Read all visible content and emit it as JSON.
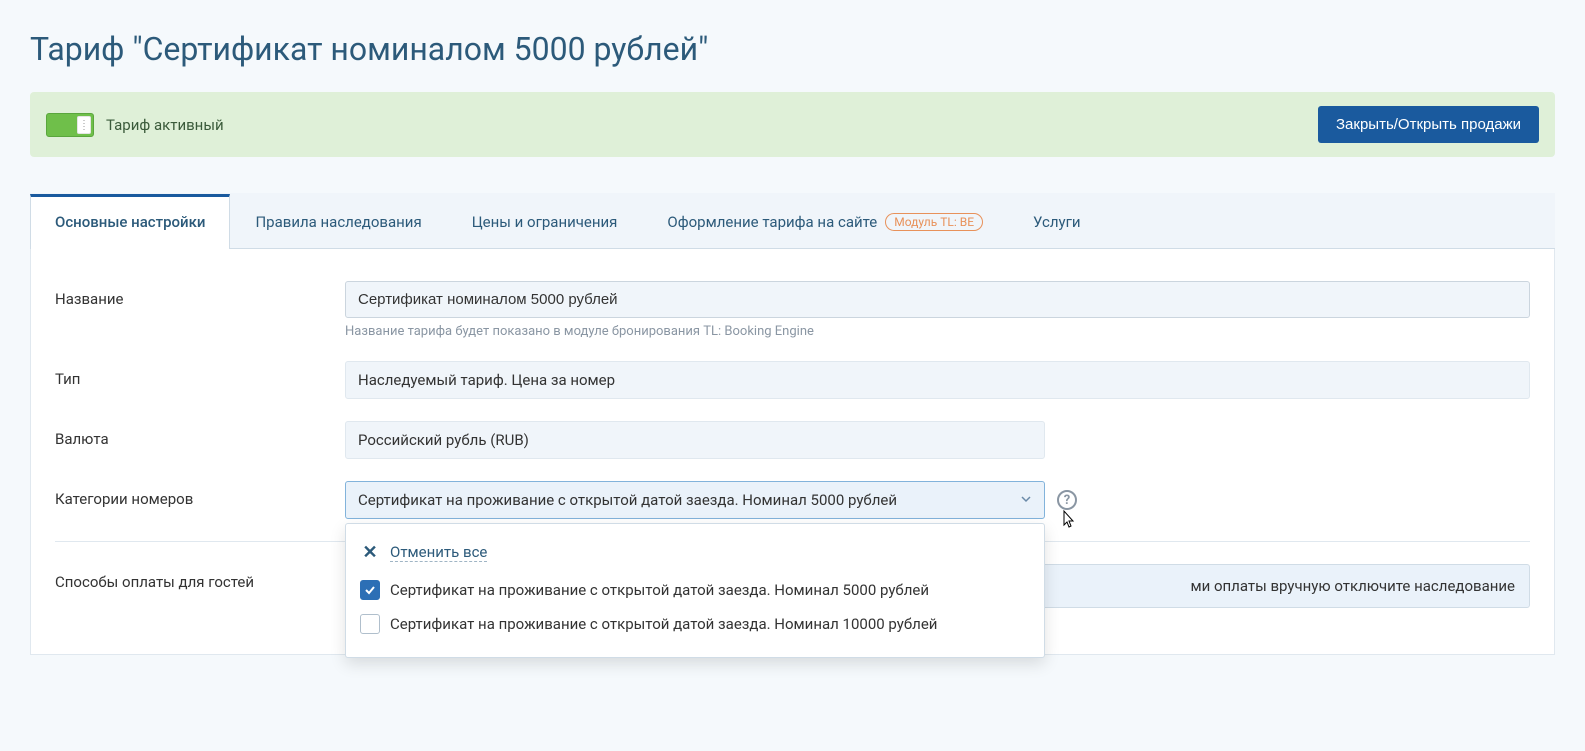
{
  "page_title": "Тариф \"Сертификат номиналом 5000 рублей\"",
  "status": {
    "label": "Тариф активный",
    "button": "Закрыть/Открыть продажи"
  },
  "tabs": [
    {
      "label": "Основные настройки"
    },
    {
      "label": "Правила наследования"
    },
    {
      "label": "Цены и ограничения"
    },
    {
      "label": "Оформление тарифа на сайте",
      "module_badge": "Модуль TL: BE"
    },
    {
      "label": "Услуги"
    }
  ],
  "form": {
    "name_label": "Название",
    "name_value": "Сертификат номиналом 5000 рублей",
    "name_helper": "Название тарифа будет показано в модуле бронирования TL: Booking Engine",
    "type_label": "Тип",
    "type_value": "Наследуемый тариф. Цена за номер",
    "currency_label": "Валюта",
    "currency_value": "Российский рубль (RUB)",
    "categories_label": "Категории номеров",
    "categories_value": "Сертификат на проживание с открытой датой заезда. Номинал 5000 рублей",
    "payment_label": "Способы оплаты для гостей",
    "payment_notice": "ми оплаты вручную отключите наследование"
  },
  "dropdown": {
    "deselect_all": "Отменить все",
    "options": [
      {
        "label": "Сертификат на проживание с открытой датой заезда. Номинал 5000 рублей",
        "checked": true
      },
      {
        "label": "Сертификат на проживание с открытой датой заезда. Номинал 10000 рублей",
        "checked": false
      }
    ]
  }
}
